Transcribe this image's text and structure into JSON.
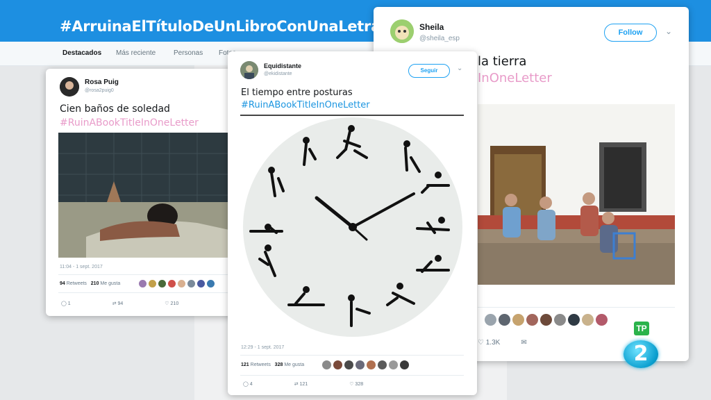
{
  "background": {
    "hashtag_title": "#ArruinaElTítuloDeUnLibroConUnaLetra",
    "tabs": [
      "Destacados",
      "Más reciente",
      "Personas",
      "Fotos"
    ]
  },
  "tweet_left": {
    "name": "Rosa Puig",
    "handle": "@rosa2puig0",
    "text": "Cien baños de soledad",
    "hashtag": "#RuinABookTitleInOneLetter",
    "timestamp": "11:04 - 1 sept. 2017",
    "retweets_count": "94",
    "retweets_label": "Retweets",
    "likes_count": "210",
    "likes_label": "Me gusta",
    "reply_count": "1",
    "retweet_action_count": "94",
    "like_action_count": "210"
  },
  "tweet_center": {
    "name": "Equidistante",
    "handle": "@ekidistante",
    "follow_label": "Seguir",
    "text": "El tiempo entre posturas",
    "hashtag": "#RuinABookTitleInOneLetter",
    "timestamp": "12:29 - 1 sept. 2017",
    "retweets_count": "121",
    "retweets_label": "Retweets",
    "likes_count": "328",
    "likes_label": "Me gusta",
    "reply_count": "4",
    "retweet_action_count": "121",
    "like_action_count": "328"
  },
  "tweet_right": {
    "name": "Sheila",
    "handle": "@sheila_esp",
    "follow_label": "Follow",
    "text": "la tierra",
    "hashtag": "InOneLetter",
    "like_action_count": "1.3K"
  },
  "overlay": {
    "tp_badge": "TP",
    "channel_logo": "2"
  }
}
